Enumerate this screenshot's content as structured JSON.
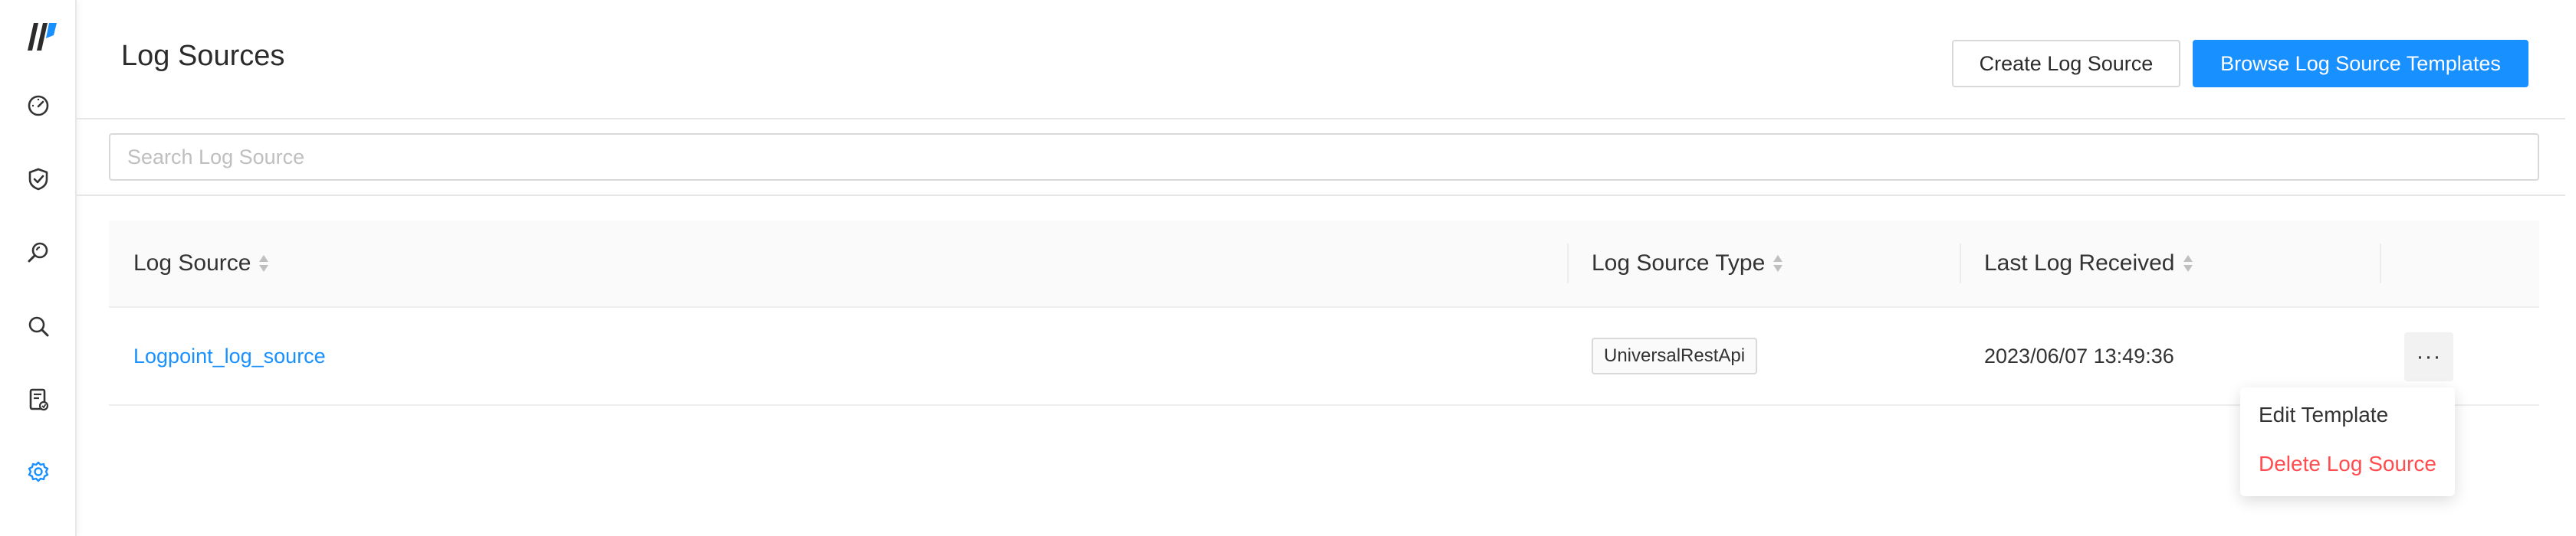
{
  "sidebar": {
    "logo": "logpoint-logo",
    "items": [
      {
        "icon": "dashboard-gauge-icon",
        "active": false
      },
      {
        "icon": "shield-check-icon",
        "active": false
      },
      {
        "icon": "investigate-search-icon",
        "active": false
      },
      {
        "icon": "search-icon",
        "active": false
      },
      {
        "icon": "report-document-icon",
        "active": false
      },
      {
        "icon": "settings-gear-icon",
        "active": true
      }
    ]
  },
  "header": {
    "title": "Log Sources",
    "create_button": "Create Log Source",
    "browse_button": "Browse Log Source Templates"
  },
  "search": {
    "placeholder": "Search Log Source",
    "value": ""
  },
  "table": {
    "columns": [
      "Log Source",
      "Log Source Type",
      "Last Log Received"
    ],
    "rows": [
      {
        "log_source": "Logpoint_log_source",
        "type": "UniversalRestApi",
        "last_received": "2023/06/07 13:49:36",
        "actions": "···"
      }
    ]
  },
  "row_menu": {
    "items": [
      "Edit Template",
      "Delete Log Source"
    ]
  },
  "colors": {
    "primary": "#1890ff",
    "danger": "#ff4d4f",
    "header_bg": "#fafafa"
  }
}
